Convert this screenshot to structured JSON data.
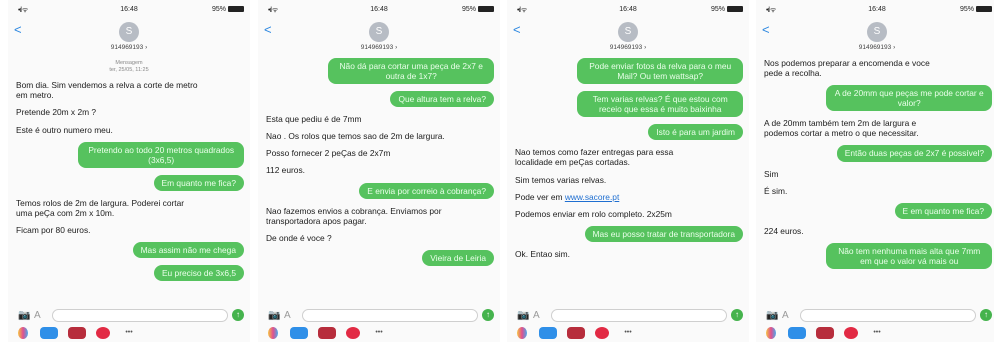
{
  "status": {
    "signal": "•ıl ᯤ",
    "time": "16:48",
    "battery": "95%"
  },
  "header": {
    "back": "<",
    "avatar_initial": "S",
    "contact_number": "914969193 ›"
  },
  "composer": {
    "camera": "📷",
    "appstore": "A",
    "send": "↑",
    "more": "•••"
  },
  "screens": [
    {
      "timestamp": "Mensagem\nter, 25/05, 11:25",
      "messages": [
        {
          "dir": "in",
          "text": "Bom dia. Sim vendemos a relva a corte de metro em metro."
        },
        {
          "dir": "in",
          "text": "Pretende 20m x 2m ?"
        },
        {
          "dir": "in",
          "text": "Este é outro numero meu."
        },
        {
          "dir": "out",
          "text": "Pretendo ao todo 20 metros quadrados (3x6,5)"
        },
        {
          "dir": "out",
          "text": "Em quanto me fica?"
        },
        {
          "dir": "in",
          "text": "Temos rolos de 2m de largura. Poderei cortar uma peÇa com 2m x 10m."
        },
        {
          "dir": "in",
          "text": "Ficam por 80 euros."
        },
        {
          "dir": "out",
          "text": "Mas assim não me chega"
        },
        {
          "dir": "out",
          "text": "Eu preciso de 3x6,5"
        }
      ]
    },
    {
      "messages": [
        {
          "dir": "out",
          "text": "Não dá para cortar uma peça de 2x7 e outra de 1x7?"
        },
        {
          "dir": "out",
          "text": "Que altura tem a relva?"
        },
        {
          "dir": "in",
          "text": "Esta que pediu é de 7mm"
        },
        {
          "dir": "in",
          "text": "Nao . Os rolos que temos sao de 2m de largura."
        },
        {
          "dir": "in",
          "text": "Posso fornecer 2 peÇas de 2x7m"
        },
        {
          "dir": "in",
          "text": "112 euros."
        },
        {
          "dir": "out",
          "text": "E envia por correio à cobrança?"
        },
        {
          "dir": "in",
          "text": "Nao fazemos envios a cobrança. Enviamos por transportadora apos pagar."
        },
        {
          "dir": "in",
          "text": "De onde é voce ?"
        },
        {
          "dir": "out",
          "text": "Vieira de Leiria"
        }
      ]
    },
    {
      "messages": [
        {
          "dir": "out",
          "text": "Pode enviar fotos da relva para o meu Mail? Ou tem wattsap?"
        },
        {
          "dir": "out",
          "text": "Tem varias relvas? É que estou com receio que essa é muito baixinha"
        },
        {
          "dir": "out",
          "text": "Isto é para um jardim"
        },
        {
          "dir": "in",
          "text": "Nao temos como fazer entregas para essa localidade em peÇas cortadas."
        },
        {
          "dir": "in",
          "text": "Sim temos varias relvas."
        },
        {
          "dir": "in",
          "text": "Pode ver em ",
          "link": "www.sacore.pt"
        },
        {
          "dir": "in",
          "text": "Podemos enviar em rolo completo. 2x25m"
        },
        {
          "dir": "out",
          "text": "Mas eu posso tratar de transportadora"
        },
        {
          "dir": "in",
          "text": "Ok. Entao sim."
        }
      ]
    },
    {
      "messages": [
        {
          "dir": "in",
          "text": "Nos podemos preparar a encomenda e voce pede a recolha."
        },
        {
          "dir": "out",
          "text": "A de 20mm que peças me pode cortar e valor?"
        },
        {
          "dir": "in",
          "text": "A de 20mm também tem 2m de largura e podemos cortar a metro o que necessitar."
        },
        {
          "dir": "out",
          "text": "Então duas peças de 2x7 é possível?"
        },
        {
          "dir": "in",
          "text": "Sim"
        },
        {
          "dir": "in",
          "text": "É sim."
        },
        {
          "dir": "out",
          "text": "E em quanto me fica?"
        },
        {
          "dir": "in",
          "text": "224 euros."
        },
        {
          "dir": "out",
          "text": "Não tem nenhuma mais alta que 7mm em que o valor vá mais ou"
        }
      ]
    }
  ]
}
